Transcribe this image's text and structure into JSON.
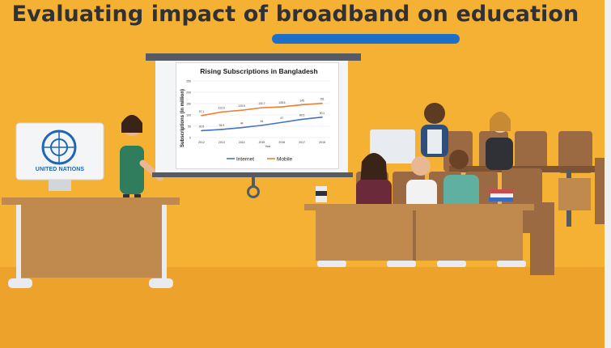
{
  "headline": "Evaluating impact of broadband on education",
  "un_label": "UNITED NATIONS",
  "colors": {
    "background": "#f5b133",
    "accent": "#1e6fc8",
    "internet": "#4472c4",
    "mobile": "#ed7d31",
    "text": "#2f3136"
  },
  "chart_data": {
    "type": "line",
    "title": "Rising Subscriptions in Bangladesh",
    "xlabel": "Year",
    "ylabel": "Subscriptions (in million)",
    "x": [
      "2012",
      "2013",
      "2014",
      "2015",
      "2016",
      "2017",
      "2018"
    ],
    "ylim": [
      0,
      250
    ],
    "yticks": [
      "0",
      "50",
      "100",
      "150",
      "200",
      "250"
    ],
    "grid": true,
    "legend": "bottom",
    "series": [
      {
        "name": "Internet",
        "color": "#4472c4",
        "values": [
          30.5,
          35.9,
          44,
          54,
          67,
          80.5,
          90.1
        ],
        "labels": [
          "30.5",
          "35.9",
          "44",
          "54",
          "67",
          "80.5",
          "90.1"
        ]
      },
      {
        "name": "Mobile",
        "color": "#ed7d31",
        "values": [
          97.1,
          112.9,
          120.6,
          131.7,
          135.6,
          145,
          151
        ],
        "labels": [
          "97.1",
          "112.9",
          "120.6",
          "131.7",
          "135.6",
          "145",
          "151"
        ]
      }
    ]
  }
}
